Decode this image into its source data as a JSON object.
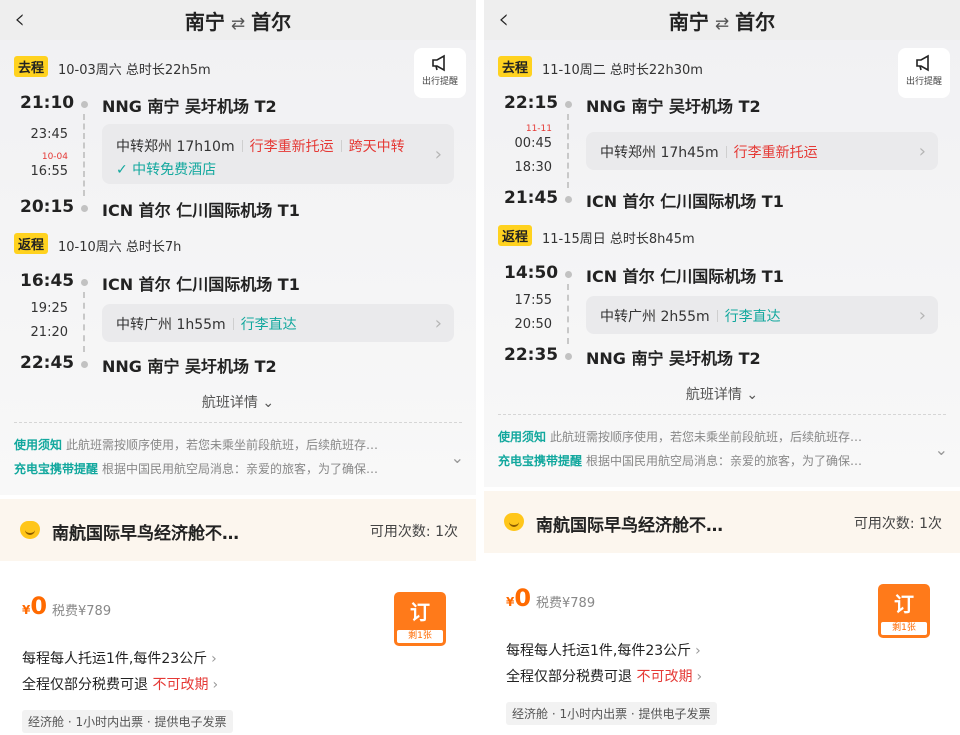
{
  "left": {
    "header": {
      "origin": "南宁",
      "swap_icon": "⇄",
      "destination": "首尔"
    },
    "remind": {
      "label": "出行提醒",
      "icon": "megaphone-icon"
    },
    "outbound": {
      "tag": "去程",
      "meta": "10-03周六 总时长22h5m",
      "depart_time": "21:10",
      "depart_airport": "NNG 南宁 吴圩机场 T2",
      "stop_arrive": "23:45",
      "stop_nextday": "10-04",
      "stop_depart": "16:55",
      "transfer_text": "中转郑州 17h10m",
      "transfer_tag1": "行李重新托运",
      "transfer_tag2": "跨天中转",
      "transfer_hotel": "✓ 中转免费酒店",
      "arrive_time": "20:15",
      "arrive_airport": "ICN 首尔 仁川国际机场 T1"
    },
    "return": {
      "tag": "返程",
      "meta": "10-10周六 总时长7h",
      "depart_time": "16:45",
      "depart_airport": "ICN 首尔 仁川国际机场 T1",
      "stop_arrive": "19:25",
      "stop_depart": "21:20",
      "transfer_text": "中转广州 1h55m",
      "transfer_tag1": "行李直达",
      "arrive_time": "22:45",
      "arrive_airport": "NNG 南宁 吴圩机场 T2"
    },
    "detail_label": "航班详情",
    "notice1_title": "使用须知",
    "notice1_text": "此航班需按顺序使用，若您未乘坐前段航班，后续航班存…",
    "notice2_title": "充电宝携带提醒",
    "notice2_text": "根据中国民用航空局消息：亲爱的旅客，为了确保…",
    "promo_title": "南航国际早鸟经济舱不…",
    "promo_count": "可用次数: 1次",
    "fare": {
      "currency": "¥",
      "price": "0",
      "tax": "税费¥789",
      "book_label": "订",
      "left_label": "剩1张",
      "rule1": "每程每人托运1件,每件23公斤",
      "rule2": "全程仅部分税费可退",
      "rule2_red": "不可改期",
      "chips": "经济舱 · 1小时内出票 · 提供电子发票"
    }
  },
  "right": {
    "header": {
      "origin": "南宁",
      "swap_icon": "⇄",
      "destination": "首尔"
    },
    "remind": {
      "label": "出行提醒",
      "icon": "megaphone-icon"
    },
    "outbound": {
      "tag": "去程",
      "meta": "11-10周二 总时长22h30m",
      "depart_time": "22:15",
      "depart_airport": "NNG 南宁 吴圩机场 T2",
      "stop_nextday": "11-11",
      "stop_arrive": "00:45",
      "stop_depart": "18:30",
      "transfer_text": "中转郑州 17h45m",
      "transfer_tag1": "行李重新托运",
      "arrive_time": "21:45",
      "arrive_airport": "ICN 首尔 仁川国际机场 T1"
    },
    "return": {
      "tag": "返程",
      "meta": "11-15周日 总时长8h45m",
      "depart_time": "14:50",
      "depart_airport": "ICN 首尔 仁川国际机场 T1",
      "stop_arrive": "17:55",
      "stop_depart": "20:50",
      "transfer_text": "中转广州 2h55m",
      "transfer_tag1": "行李直达",
      "arrive_time": "22:35",
      "arrive_airport": "NNG 南宁 吴圩机场 T2"
    },
    "detail_label": "航班详情",
    "notice1_title": "使用须知",
    "notice1_text": "此航班需按顺序使用，若您未乘坐前段航班，后续航班存…",
    "notice2_title": "充电宝携带提醒",
    "notice2_text": "根据中国民用航空局消息：亲爱的旅客，为了确保…",
    "promo_title": "南航国际早鸟经济舱不…",
    "promo_count": "可用次数: 1次",
    "fare": {
      "currency": "¥",
      "price": "0",
      "tax": "税费¥789",
      "book_label": "订",
      "left_label": "剩1张",
      "rule1": "每程每人托运1件,每件23公斤",
      "rule2": "全程仅部分税费可退",
      "rule2_red": "不可改期",
      "chips": "经济舱 · 1小时内出票 · 提供电子发票"
    }
  },
  "colors": {
    "accent_yellow": "#ffd21f",
    "price_orange": "#ff6a00",
    "warn_red": "#e53935",
    "teal": "#13a89e"
  }
}
